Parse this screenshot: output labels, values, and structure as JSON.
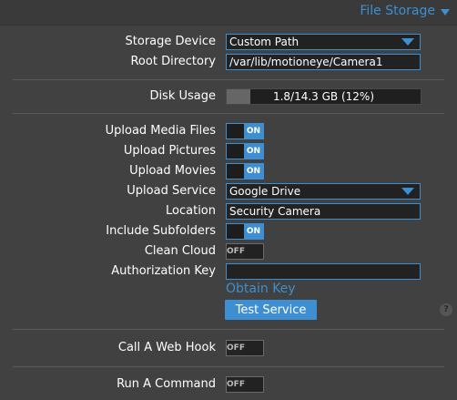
{
  "section": {
    "title": "File Storage",
    "icon": "chevron-down-icon"
  },
  "storage": {
    "device_label": "Storage Device",
    "device_value": "Custom Path",
    "root_label": "Root Directory",
    "root_value": "/var/lib/motioneye/Camera1"
  },
  "disk": {
    "label": "Disk Usage",
    "text": "1.8/14.3 GB (12%)",
    "used_fraction": 0.12
  },
  "upload": {
    "media_label": "Upload Media Files",
    "media_state": "ON",
    "pictures_label": "Upload Pictures",
    "pictures_state": "ON",
    "movies_label": "Upload Movies",
    "movies_state": "ON",
    "service_label": "Upload Service",
    "service_value": "Google Drive",
    "location_label": "Location",
    "location_value": "Security Camera",
    "subfolders_label": "Include Subfolders",
    "subfolders_state": "ON",
    "clean_label": "Clean Cloud",
    "clean_state": "OFF",
    "auth_label": "Authorization Key",
    "auth_value": "",
    "obtain_key": "Obtain Key",
    "test_service": "Test Service",
    "help": "?"
  },
  "webhook": {
    "label": "Call A Web Hook",
    "state": "OFF"
  },
  "command": {
    "label": "Run A Command",
    "state": "OFF"
  },
  "colors": {
    "accent": "#3d8fd1",
    "background": "#414141",
    "field_bg": "#222222"
  }
}
